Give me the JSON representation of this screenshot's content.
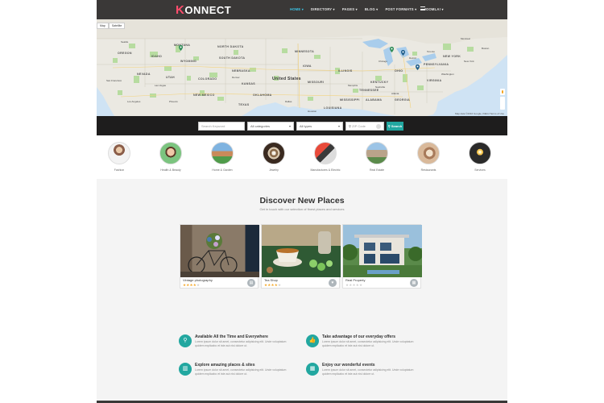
{
  "header": {
    "logo": "ONNECT",
    "logo_k": "K",
    "nav": [
      "HOME ▾",
      "DIRECTORY ▾",
      "PAGES ▾",
      "BLOG ▾",
      "POST FORMATS ▾",
      "JOOMLA! ▾"
    ]
  },
  "map": {
    "tabs": [
      "Map",
      "Satellite"
    ],
    "footer": "Map data ©2016 Google, INEGI   Terms of Use",
    "country_label": "United States",
    "states": [
      "NORTH DAKOTA",
      "SOUTH DAKOTA",
      "NEBRASKA",
      "KANSAS",
      "OKLAHOMA",
      "TEXAS",
      "NEW MEXICO",
      "COLORADO",
      "UTAH",
      "NEVADA",
      "IDAHO",
      "MONTANA",
      "WYOMING",
      "OREGON",
      "MISSOURI",
      "ILLINOIS",
      "IOWA",
      "MINNESOTA",
      "TENNESSEE",
      "ALABAMA",
      "GEORGIA",
      "OHIO",
      "PENNSYLVANIA",
      "NEW YORK",
      "VIRGINIA",
      "KENTUCKY",
      "MISSISSIPPI",
      "LOUISIANA"
    ],
    "cities": [
      "Chicago",
      "Detroit",
      "Toronto",
      "Montreal",
      "Boston",
      "New York",
      "Washington",
      "Dallas",
      "Houston",
      "Denver",
      "Las Vegas",
      "Los Angeles",
      "San Francisco",
      "Seattle",
      "Atlanta",
      "Phoenix",
      "Memphis",
      "Nashville"
    ]
  },
  "search": {
    "keyword_placeholder": "Search Keyword",
    "categories_value": "All categories",
    "types_value": "All types",
    "zip_placeholder": "ZIP Code",
    "button_label": "Search",
    "search_icon": "search-icon",
    "location_icon": "map-pin-icon"
  },
  "categories": [
    {
      "label": "Fashion"
    },
    {
      "label": "Health & Beauty"
    },
    {
      "label": "Home & Garden"
    },
    {
      "label": "Jewelry"
    },
    {
      "label": "Manufactures & Electric"
    },
    {
      "label": "Real Estate"
    },
    {
      "label": "Restaurants"
    },
    {
      "label": "Services"
    }
  ],
  "discover": {
    "title": "Discover New Places",
    "subtitle": "Get in touch with our selection of finest places and services",
    "cards": [
      {
        "name": "Vintage photography",
        "stars": 4,
        "icon": "briefcase-icon"
      },
      {
        "name": "Tea Shop",
        "stars": 4,
        "icon": "heart-icon"
      },
      {
        "name": "Real Property",
        "stars": 0,
        "icon": "building-icon"
      }
    ]
  },
  "features": [
    {
      "title": "Available All the Time and Everywhere",
      "desc": "Lorem ipsum dolor sit amet, consectetur adipisicing elit. Unde voluptatum quidem explicabo et iste aut nisi dolore ut.",
      "icon": "search-icon"
    },
    {
      "title": "Take advantage of our everyday offers",
      "desc": "Lorem ipsum dolor sit amet, consectetur adipisicing elit. Unde voluptatum quidem explicabo et iste aut nisi dolore ut.",
      "icon": "thumbs-up-icon"
    },
    {
      "title": "Explore amazing places & sites",
      "desc": "Lorem ipsum dolor sit amet, consectetur adipisicing elit. Unde voluptatum quidem explicabo et iste aut nisi dolore ut.",
      "icon": "map-icon"
    },
    {
      "title": "Enjoy our wonderful events",
      "desc": "Lorem ipsum dolor sit amet, consectetur adipisicing elit. Unde voluptatum quidem explicabo et iste aut nisi dolore ut.",
      "icon": "calendar-icon"
    }
  ],
  "colors": {
    "accent": "#22a7a0",
    "header_bg": "#3a3837",
    "nav_active": "#3cc6e8",
    "star": "#f5a623",
    "logo_k": "#ff4d6d"
  }
}
